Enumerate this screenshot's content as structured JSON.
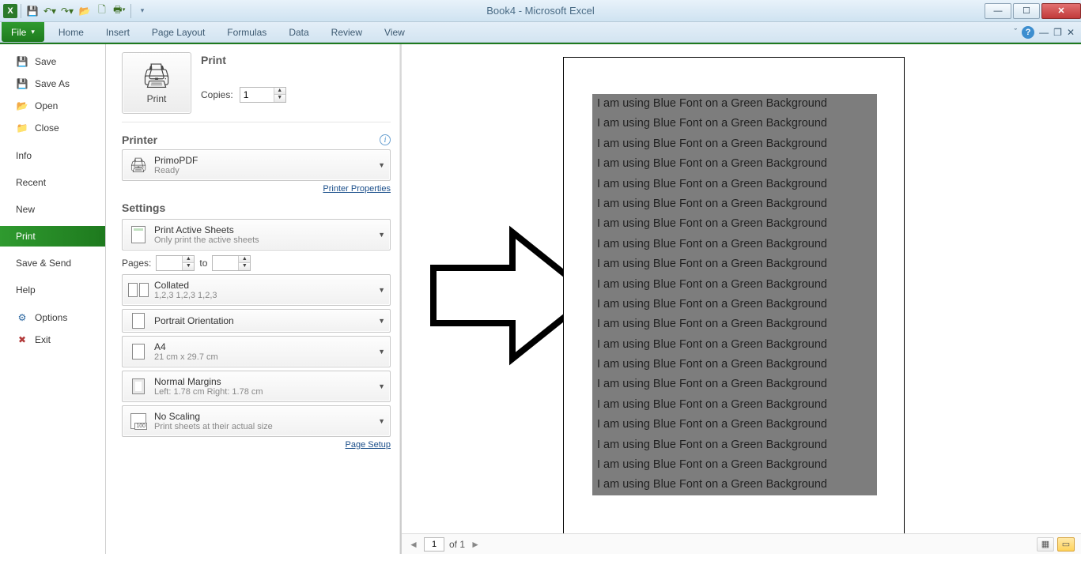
{
  "titlebar": {
    "title": "Book4 - Microsoft Excel"
  },
  "ribbon": {
    "file": "File",
    "tabs": [
      "Home",
      "Insert",
      "Page Layout",
      "Formulas",
      "Data",
      "Review",
      "View"
    ]
  },
  "backstage": {
    "items": [
      {
        "label": "Save",
        "icon": "save"
      },
      {
        "label": "Save As",
        "icon": "saveas"
      },
      {
        "label": "Open",
        "icon": "open"
      },
      {
        "label": "Close",
        "icon": "closei"
      }
    ],
    "plain": [
      "Info",
      "Recent",
      "New"
    ],
    "selected": "Print",
    "after": [
      "Save & Send",
      "Help"
    ],
    "bottom": [
      {
        "label": "Options",
        "icon": "options"
      },
      {
        "label": "Exit",
        "icon": "exit"
      }
    ]
  },
  "print": {
    "heading": "Print",
    "button": "Print",
    "copies_label": "Copies:",
    "copies_value": "1",
    "printer_heading": "Printer",
    "printer_name": "PrimoPDF",
    "printer_status": "Ready",
    "printer_properties": "Printer Properties",
    "settings_heading": "Settings",
    "active_sheets": {
      "line1": "Print Active Sheets",
      "line2": "Only print the active sheets"
    },
    "pages_label": "Pages:",
    "to_label": "to",
    "collated": {
      "line1": "Collated",
      "line2": "1,2,3   1,2,3   1,2,3"
    },
    "orientation": {
      "line1": "Portrait Orientation",
      "line2": ""
    },
    "paper": {
      "line1": "A4",
      "line2": "21 cm x 29.7 cm"
    },
    "margins": {
      "line1": "Normal Margins",
      "line2": "Left: 1.78 cm   Right: 1.78 cm"
    },
    "scaling": {
      "line1": "No Scaling",
      "line2": "Print sheets at their actual size"
    },
    "page_setup": "Page Setup"
  },
  "preview": {
    "line_text": "I am using Blue Font on a Green Background",
    "line_count": 20,
    "pager": {
      "current": "1",
      "total": "of 1"
    }
  }
}
